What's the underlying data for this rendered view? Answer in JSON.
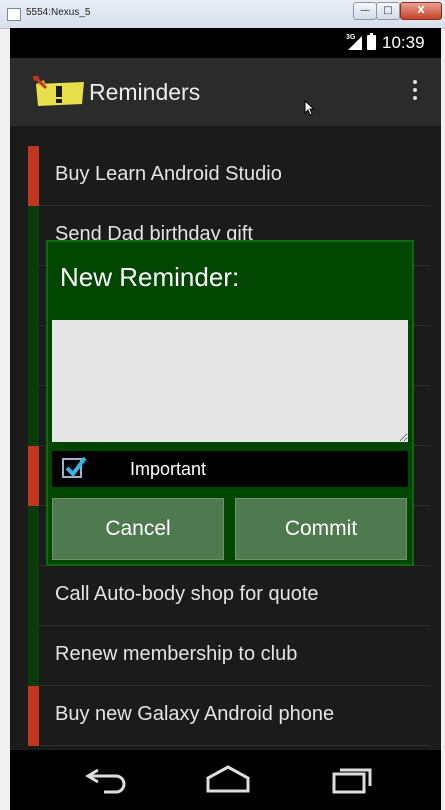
{
  "window": {
    "title": "5554:Nexus_5",
    "close_label": "X"
  },
  "statusbar": {
    "network": "3G",
    "time": "10:39"
  },
  "actionbar": {
    "title": "Reminders",
    "logo_icon": "sticky-note-pin-icon",
    "menu_icon": "overflow-menu-icon"
  },
  "reminders": [
    {
      "text": "Buy Learn Android Studio",
      "important": true
    },
    {
      "text": "Send Dad birthday gift",
      "important": false
    },
    {
      "text": "",
      "important": false
    },
    {
      "text": "",
      "important": false
    },
    {
      "text": "",
      "important": false
    },
    {
      "text": "",
      "important": true
    },
    {
      "text": "",
      "important": false
    },
    {
      "text": "Call Auto-body shop for quote",
      "important": false
    },
    {
      "text": "Renew membership to club",
      "important": false
    },
    {
      "text": "Buy new Galaxy Android phone",
      "important": true
    }
  ],
  "dialog": {
    "title": "New Reminder:",
    "input_value": "",
    "important_label": "Important",
    "important_checked": true,
    "cancel_label": "Cancel",
    "commit_label": "Commit"
  },
  "colors": {
    "important_stripe": "#c1361f",
    "normal_stripe": "#0b3a0b",
    "dialog_bg": "#004600",
    "button_bg": "#4f7a4f"
  },
  "navbar": {
    "icons": [
      "back-icon",
      "home-icon",
      "recent-apps-icon"
    ]
  }
}
